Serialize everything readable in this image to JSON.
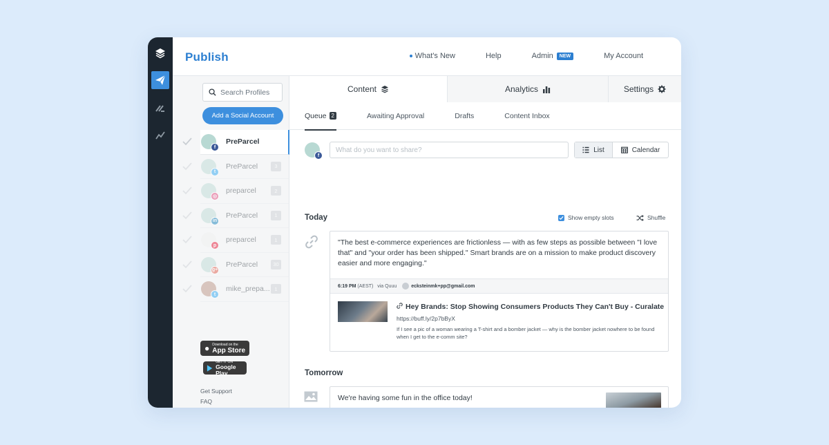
{
  "header": {
    "title": "Publish",
    "nav": [
      {
        "label": "What's New",
        "dot": true
      },
      {
        "label": "Help"
      },
      {
        "label": "Admin",
        "badge": "NEW"
      },
      {
        "label": "My Account"
      }
    ]
  },
  "rail": {
    "items": [
      {
        "icon": "layers-icon",
        "active": false
      },
      {
        "icon": "paper-plane-icon",
        "active": true
      },
      {
        "icon": "reply-icon",
        "active": false
      },
      {
        "icon": "analytics-icon",
        "active": false
      }
    ]
  },
  "sidebar": {
    "search_placeholder": "Search Profiles",
    "add_button": "Add a Social Account",
    "profiles": [
      {
        "name": "PreParcel",
        "network": "facebook",
        "count": "",
        "active": true
      },
      {
        "name": "PreParcel",
        "network": "twitter",
        "count": "3"
      },
      {
        "name": "preparcel",
        "network": "instagram",
        "count": "2"
      },
      {
        "name": "PreParcel",
        "network": "linkedin",
        "count": "1"
      },
      {
        "name": "preparcel",
        "network": "pinterest",
        "count": "1"
      },
      {
        "name": "PreParcel",
        "network": "google-plus",
        "count": "30"
      },
      {
        "name": "mike_prepa...",
        "network": "twitter",
        "count": "1"
      }
    ],
    "app_store": {
      "small": "Download on the",
      "big": "App Store"
    },
    "google_play": {
      "small": "GET IT ON",
      "big": "Google Play"
    },
    "links": [
      "Get Support",
      "FAQ"
    ]
  },
  "tabs": {
    "content": "Content",
    "analytics": "Analytics",
    "settings": "Settings"
  },
  "subtabs": {
    "queue": "Queue",
    "queue_count": "2",
    "awaiting": "Awaiting Approval",
    "drafts": "Drafts",
    "inbox": "Content Inbox"
  },
  "composer": {
    "placeholder": "What do you want to share?",
    "list": "List",
    "calendar": "Calendar"
  },
  "today": {
    "label": "Today",
    "show_empty": "Show empty slots",
    "shuffle": "Shuffle",
    "post": {
      "text": "\"The best e-commerce experiences are frictionless — with as few steps as possible between \"I love that\" and \"your order has been shipped.\" Smart brands are on a mission to make product discovery easier and more engaging.\"",
      "time": "6:19 PM",
      "timezone": "(AEST)",
      "via": "via Quuu",
      "email": "ecksteinmk+pp@gmail.com",
      "link_title": "Hey Brands: Stop Showing Consumers Products They Can't Buy - Curalate",
      "link_url": "https://buff.ly/2p7bByX",
      "link_desc": "If I see a pic of a woman wearing a T-shirt and a bomber jacket — why is the bomber jacket nowhere to be found when I get to the e-comm site?"
    }
  },
  "tomorrow": {
    "label": "Tomorrow",
    "post": {
      "text": "We're having some fun in the office today!"
    }
  },
  "colors": {
    "accent": "#3d8fde",
    "rail": "#1c2630",
    "background": "#dcebfb"
  }
}
